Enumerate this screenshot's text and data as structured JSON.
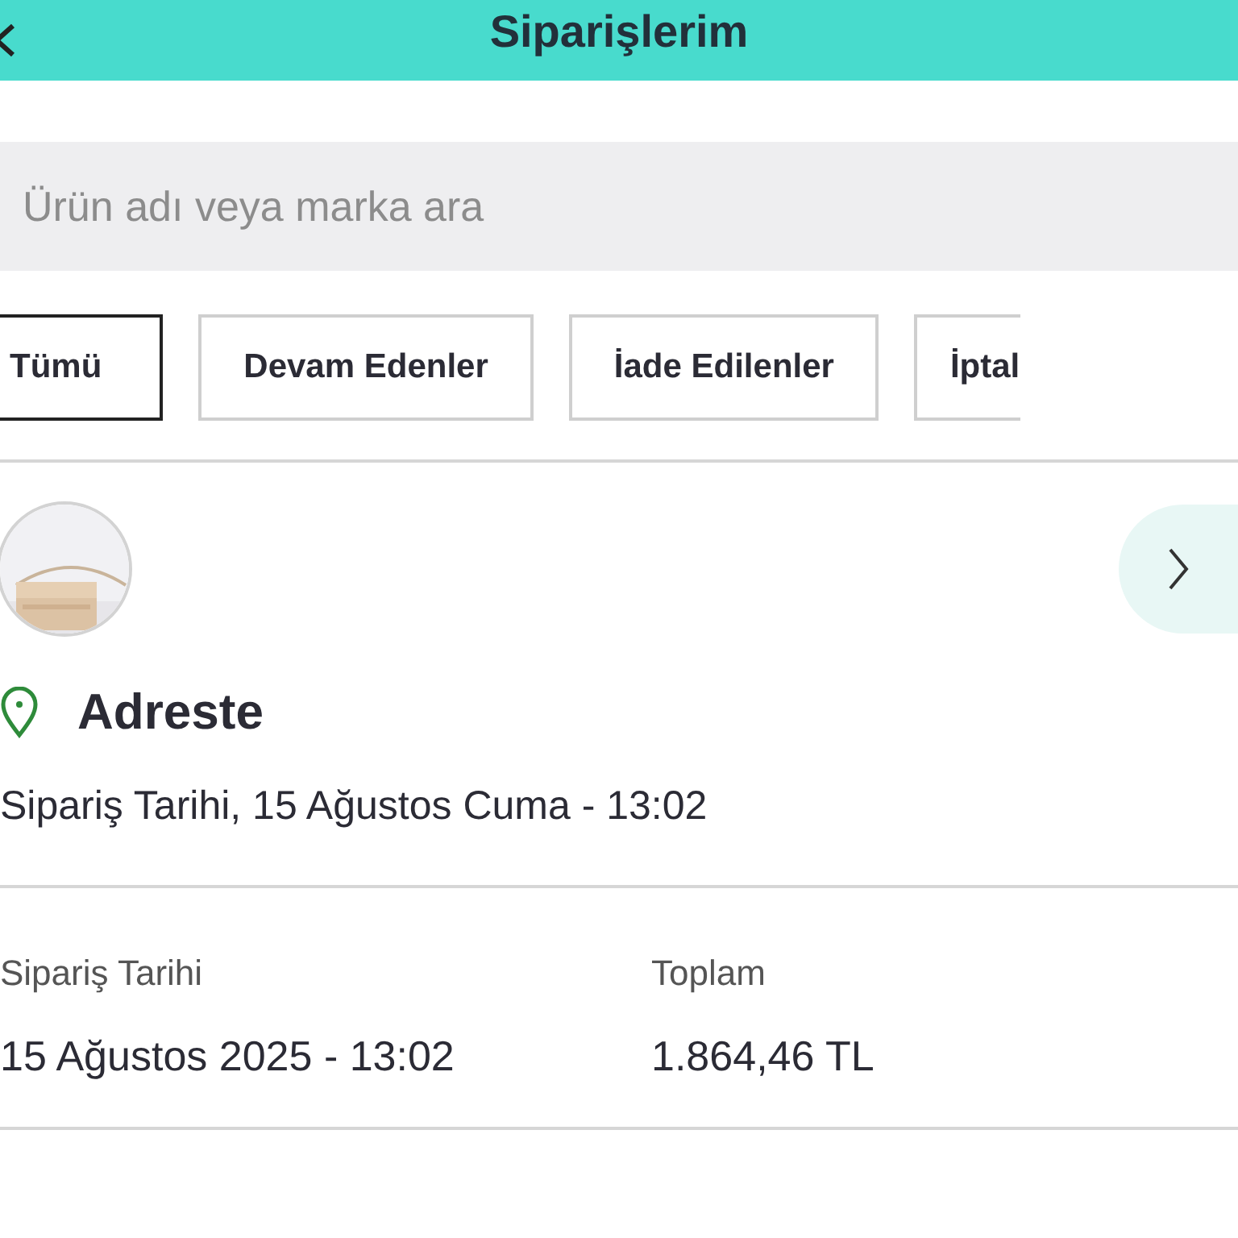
{
  "header": {
    "title": "Siparişlerim"
  },
  "search": {
    "placeholder": "Ürün adı veya marka ara"
  },
  "tabs": [
    {
      "label": "Tümü",
      "selected": true
    },
    {
      "label": "Devam Edenler",
      "selected": false
    },
    {
      "label": "İade Edilenler",
      "selected": false
    },
    {
      "label": "İptal",
      "selected": false
    }
  ],
  "order": {
    "delivery_status": "Adreste",
    "order_date_line": "Sipariş Tarihi, 15 Ağustos Cuma - 13:02",
    "details": [
      {
        "label": "Sipariş Tarihi",
        "value": "15 Ağustos 2025 - 13:02"
      },
      {
        "label": "Toplam",
        "value": "1.864,46 TL"
      }
    ]
  }
}
